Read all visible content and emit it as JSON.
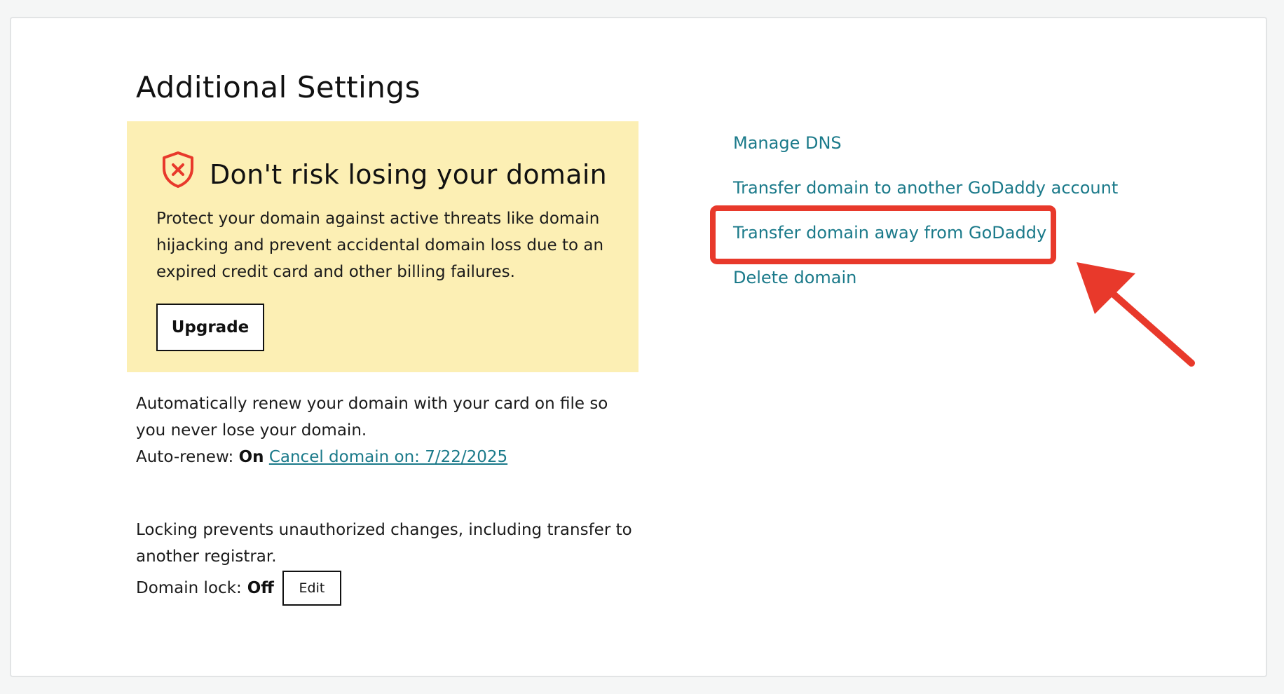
{
  "section": {
    "title": "Additional Settings"
  },
  "promo": {
    "title": "Don't risk losing your domain",
    "description": "Protect your domain against active threats like domain hijacking and prevent accidental domain loss due to an expired credit card and other billing failures.",
    "button_label": "Upgrade",
    "icon": "shield-x-icon",
    "background_color": "#fcefb4",
    "icon_color": "#e8392b"
  },
  "auto_renew": {
    "description": "Automatically renew your domain with your card on file so you never lose your domain.",
    "label": "Auto-renew:",
    "status": "On",
    "cancel_link": "Cancel domain on: 7/22/2025"
  },
  "domain_lock": {
    "description": "Locking prevents unauthorized changes, including transfer to another registrar.",
    "label": "Domain lock:",
    "status": "Off",
    "edit_label": "Edit"
  },
  "links": [
    {
      "label": "Manage DNS"
    },
    {
      "label": "Transfer domain to another GoDaddy account"
    },
    {
      "label": "Transfer domain away from GoDaddy"
    },
    {
      "label": "Delete domain"
    }
  ],
  "annotation": {
    "highlight_color": "#e8392b",
    "highlighted_link": "Transfer domain away from GoDaddy"
  },
  "colors": {
    "link": "#1b7a8a",
    "text": "#111111",
    "page_background": "#f5f6f6"
  }
}
